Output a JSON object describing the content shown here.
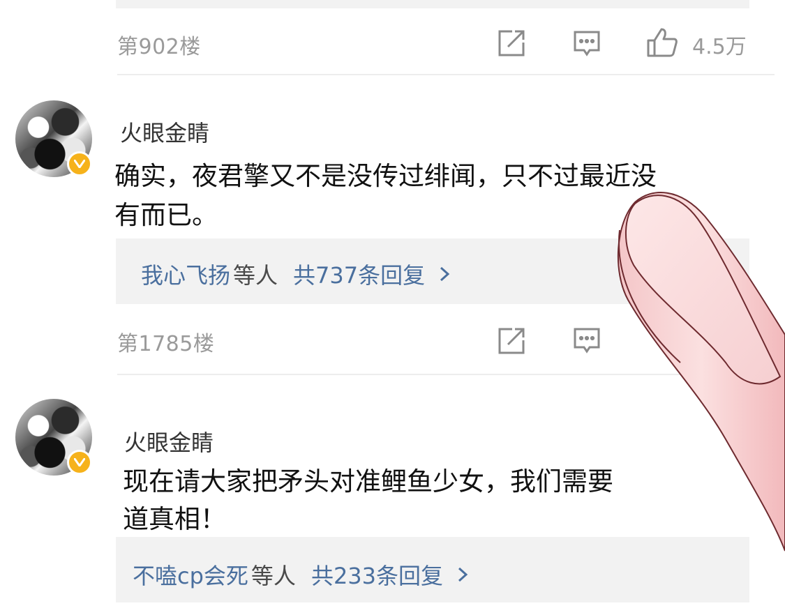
{
  "comments": [
    {
      "floor": "第902楼",
      "likes": "4.5万"
    },
    {
      "username": "火眼金睛",
      "text_line1": "确实，夜君擎又不是没传过绯闻，只不过最近没",
      "text_line2": "有而已。",
      "reply_user": "我心飞扬",
      "reply_mid": "等人",
      "reply_count": "共737条回复",
      "floor": "第1785楼"
    },
    {
      "username": "火眼金睛",
      "text_line1": "现在请大家把矛头对准鲤鱼少女，我们需要",
      "text_line2": "道真相！",
      "reply_user": "不嗑cp会死",
      "reply_mid": "等人",
      "reply_count": "共233条回复"
    }
  ],
  "icons": {
    "share": "share-icon",
    "comment": "comment-icon",
    "like": "thumbs-up-icon",
    "verified": "verified-badge-icon",
    "chevron": "chevron-right-icon"
  },
  "colors": {
    "link": "#4a6f9e",
    "badge": "#f6b21b",
    "meta": "#9a9a9a",
    "reply_bg": "#f2f2f2"
  }
}
